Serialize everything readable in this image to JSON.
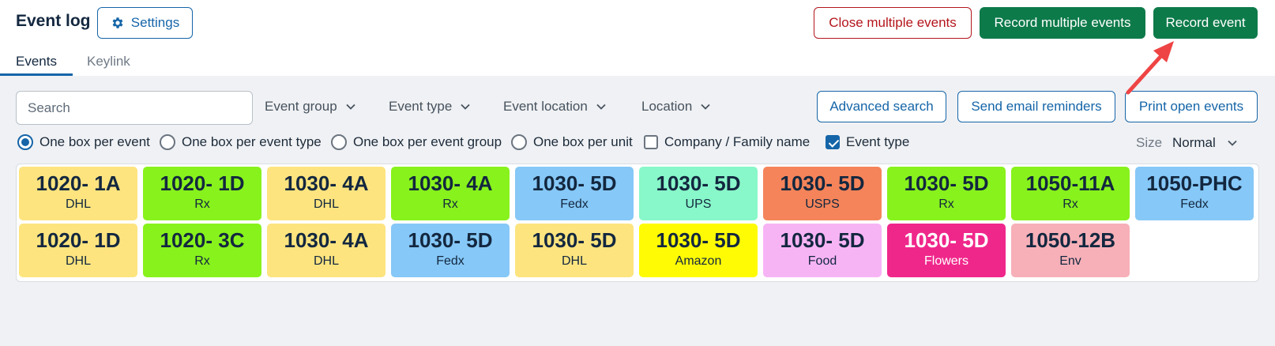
{
  "header": {
    "title": "Event log",
    "settings_label": "Settings",
    "close_multiple_label": "Close multiple events",
    "record_multiple_label": "Record multiple events",
    "record_event_label": "Record event"
  },
  "tabs": [
    {
      "label": "Events",
      "active": true
    },
    {
      "label": "Keylink",
      "active": false
    }
  ],
  "filters": {
    "search_placeholder": "Search",
    "search_value": "",
    "event_group": "Event group",
    "event_type": "Event type",
    "event_location": "Event location",
    "location": "Location"
  },
  "actions": {
    "advanced_search": "Advanced search",
    "send_reminders": "Send email reminders",
    "print_open": "Print open events"
  },
  "options": {
    "one_box_per_event": "One box per event",
    "one_box_per_event_type": "One box per event type",
    "one_box_per_event_group": "One box per event group",
    "one_box_per_unit": "One box per unit",
    "company_family_name": "Company / Family name",
    "event_type": "Event type",
    "selected_radio": "one_box_per_event",
    "company_checked": false,
    "event_type_checked": true
  },
  "size": {
    "label": "Size",
    "value": "Normal"
  },
  "tiles": [
    {
      "unit": "1020- 1A",
      "type": "DHL",
      "bg": "#fde47f",
      "fg": "#13273f"
    },
    {
      "unit": "1020- 1D",
      "type": "Rx",
      "bg": "#88f21c",
      "fg": "#13273f"
    },
    {
      "unit": "1030- 4A",
      "type": "DHL",
      "bg": "#fde47f",
      "fg": "#13273f"
    },
    {
      "unit": "1030- 4A",
      "type": "Rx",
      "bg": "#88f21c",
      "fg": "#13273f"
    },
    {
      "unit": "1030- 5D",
      "type": "Fedx",
      "bg": "#86c8f7",
      "fg": "#13273f"
    },
    {
      "unit": "1030- 5D",
      "type": "UPS",
      "bg": "#88f7c9",
      "fg": "#13273f"
    },
    {
      "unit": "1030- 5D",
      "type": "USPS",
      "bg": "#f5845a",
      "fg": "#13273f"
    },
    {
      "unit": "1030- 5D",
      "type": "Rx",
      "bg": "#88f21c",
      "fg": "#13273f"
    },
    {
      "unit": "1050-11A",
      "type": "Rx",
      "bg": "#88f21c",
      "fg": "#13273f"
    },
    {
      "unit": "1050-PHC",
      "type": "Fedx",
      "bg": "#86c8f7",
      "fg": "#13273f"
    },
    {
      "unit": "1020- 1D",
      "type": "DHL",
      "bg": "#fde47f",
      "fg": "#13273f"
    },
    {
      "unit": "1020- 3C",
      "type": "Rx",
      "bg": "#88f21c",
      "fg": "#13273f"
    },
    {
      "unit": "1030- 4A",
      "type": "DHL",
      "bg": "#fde47f",
      "fg": "#13273f"
    },
    {
      "unit": "1030- 5D",
      "type": "Fedx",
      "bg": "#86c8f7",
      "fg": "#13273f"
    },
    {
      "unit": "1030- 5D",
      "type": "DHL",
      "bg": "#fde47f",
      "fg": "#13273f"
    },
    {
      "unit": "1030- 5D",
      "type": "Amazon",
      "bg": "#fffb04",
      "fg": "#13273f"
    },
    {
      "unit": "1030- 5D",
      "type": "Food",
      "bg": "#f7b4f5",
      "fg": "#13273f"
    },
    {
      "unit": "1030- 5D",
      "type": "Flowers",
      "bg": "#f0278b",
      "fg": "#ffffff"
    },
    {
      "unit": "1050-12B",
      "type": "Env",
      "bg": "#f7b0b8",
      "fg": "#13273f"
    }
  ],
  "colors": {
    "accent": "#1565a8",
    "danger": "#b4161d",
    "primary_green": "#0d7a4a",
    "annotation_arrow": "#ef4444"
  }
}
